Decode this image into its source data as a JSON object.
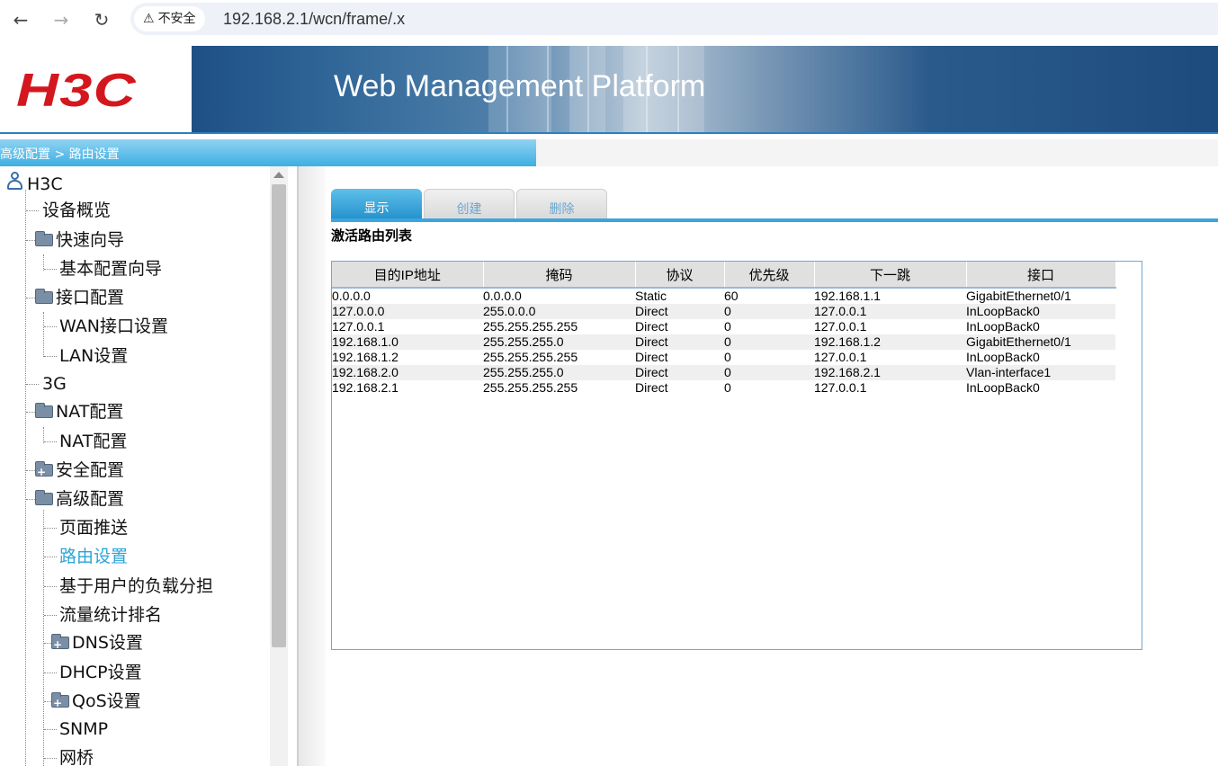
{
  "browser": {
    "security_label": "不安全",
    "url": "192.168.2.1/wcn/frame/.x"
  },
  "header": {
    "logo": "H3C",
    "platform_title": "Web Management Platform"
  },
  "breadcrumb": "高级配置 > 路由设置",
  "sidebar": {
    "root": "H3C",
    "items": [
      {
        "label": "设备概览"
      },
      {
        "label": "快速向导"
      },
      {
        "label": "基本配置向导"
      },
      {
        "label": "接口配置"
      },
      {
        "label": "WAN接口设置"
      },
      {
        "label": "LAN设置"
      },
      {
        "label": "3G"
      },
      {
        "label": "NAT配置"
      },
      {
        "label": "NAT配置"
      },
      {
        "label": "安全配置"
      },
      {
        "label": "高级配置"
      },
      {
        "label": "页面推送"
      },
      {
        "label": "路由设置"
      },
      {
        "label": "基于用户的负载分担"
      },
      {
        "label": "流量统计排名"
      },
      {
        "label": "DNS设置"
      },
      {
        "label": "DHCP设置"
      },
      {
        "label": "QoS设置"
      },
      {
        "label": "SNMP"
      },
      {
        "label": "网桥"
      }
    ]
  },
  "tabs": {
    "display": "显示",
    "create": "创建",
    "delete": "删除"
  },
  "list_title": "激活路由列表",
  "route_table": {
    "columns": [
      "目的IP地址",
      "掩码",
      "协议",
      "优先级",
      "下一跳",
      "接口"
    ],
    "rows": [
      [
        "0.0.0.0",
        "0.0.0.0",
        "Static",
        "60",
        "192.168.1.1",
        "GigabitEthernet0/1"
      ],
      [
        "127.0.0.0",
        "255.0.0.0",
        "Direct",
        "0",
        "127.0.0.1",
        "InLoopBack0"
      ],
      [
        "127.0.0.1",
        "255.255.255.255",
        "Direct",
        "0",
        "127.0.0.1",
        "InLoopBack0"
      ],
      [
        "192.168.1.0",
        "255.255.255.0",
        "Direct",
        "0",
        "192.168.1.2",
        "GigabitEthernet0/1"
      ],
      [
        "192.168.1.2",
        "255.255.255.255",
        "Direct",
        "0",
        "127.0.0.1",
        "InLoopBack0"
      ],
      [
        "192.168.2.0",
        "255.255.255.0",
        "Direct",
        "0",
        "192.168.2.1",
        "Vlan-interface1"
      ],
      [
        "192.168.2.1",
        "255.255.255.255",
        "Direct",
        "0",
        "127.0.0.1",
        "InLoopBack0"
      ]
    ]
  }
}
